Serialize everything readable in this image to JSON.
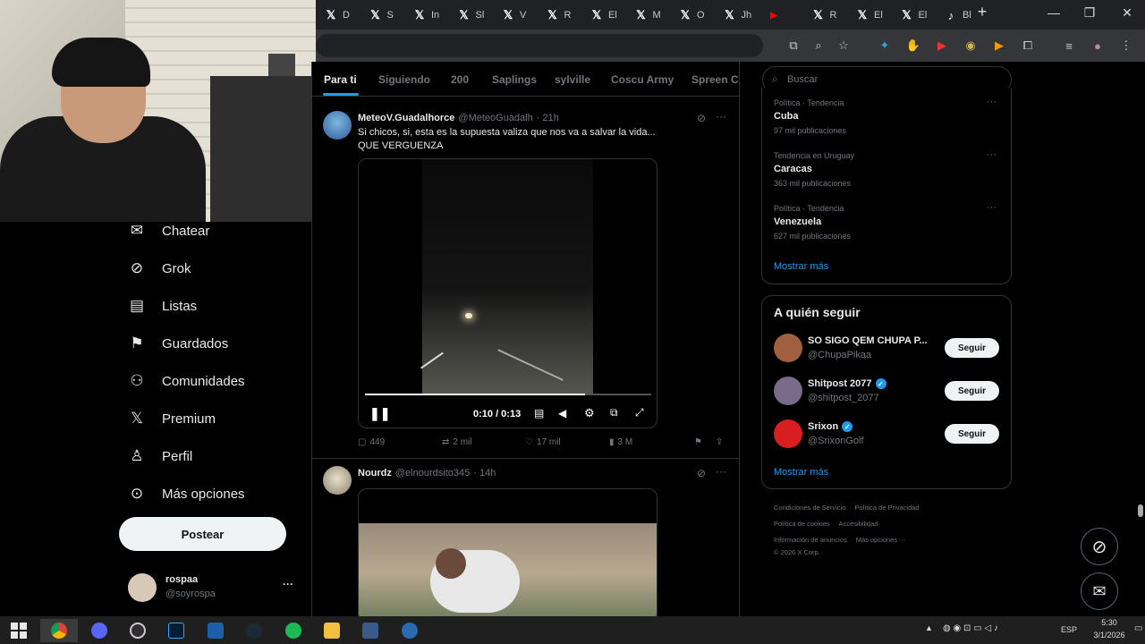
{
  "browser": {
    "tabs": [
      {
        "label": "D",
        "icon": "x-logo-icon"
      },
      {
        "label": "S",
        "icon": "x-logo-icon"
      },
      {
        "label": "In",
        "icon": "x-logo-icon"
      },
      {
        "label": "Sl",
        "icon": "x-logo-icon"
      },
      {
        "label": "V",
        "icon": "x-logo-icon"
      },
      {
        "label": "R",
        "icon": "x-logo-icon"
      },
      {
        "label": "El",
        "icon": "x-logo-icon"
      },
      {
        "label": "M",
        "icon": "x-logo-icon"
      },
      {
        "label": "O",
        "icon": "x-logo-icon"
      },
      {
        "label": "Jh",
        "icon": "x-logo-icon"
      },
      {
        "label": "",
        "icon": "youtube-icon"
      },
      {
        "label": "R",
        "icon": "x-logo-icon"
      },
      {
        "label": "El",
        "icon": "x-logo-icon"
      },
      {
        "label": "El",
        "icon": "x-logo-icon"
      },
      {
        "label": "Bl",
        "icon": "tiktok-icon"
      }
    ],
    "new_tab": "+",
    "minimize": "—",
    "maximize": "❐",
    "close": "✕"
  },
  "timeline_tabs": [
    "Para ti",
    "Siguiendo",
    "200",
    "Saplings",
    "sylville",
    "Coscu Army",
    "Spreen Cl"
  ],
  "nav": [
    {
      "label": "Chatear",
      "icon": "mail-icon"
    },
    {
      "label": "Grok",
      "icon": "grok-icon"
    },
    {
      "label": "Listas",
      "icon": "list-icon"
    },
    {
      "label": "Guardados",
      "icon": "bookmark-icon"
    },
    {
      "label": "Comunidades",
      "icon": "communities-icon"
    },
    {
      "label": "Premium",
      "icon": "x-logo-icon"
    },
    {
      "label": "Perfil",
      "icon": "person-icon"
    },
    {
      "label": "Más opciones",
      "icon": "more-circle-icon"
    }
  ],
  "post_button": "Postear",
  "account": {
    "name": "rospaa",
    "handle": "@soyrospa",
    "more": "···"
  },
  "tweets": [
    {
      "name": "MeteoV.Guadalhorce",
      "handle": "@MeteoGuadalh",
      "time": "· 21h",
      "text_line1": "Si chicos, si, esta es la supuesta valiza que nos va a salvar la vida...",
      "text_line2": "QUE VERGUENZA",
      "video_time": "0:10 / 0:13",
      "video_progress": 0.77,
      "replies": "449",
      "reposts": "2 mil",
      "likes": "17 mil",
      "views": "3 M"
    },
    {
      "name": "Nourdz",
      "handle": "@elnourdsito345",
      "time": "· 14h"
    }
  ],
  "search": {
    "placeholder": "Buscar"
  },
  "trends": [
    {
      "category": "Política · Tendencia",
      "name": "Cuba",
      "count": "97 mil publicaciones"
    },
    {
      "category": "Tendencia en Uruguay",
      "name": "Caracas",
      "count": "363 mil publicaciones"
    },
    {
      "category": "Política · Tendencia",
      "name": "Venezuela",
      "count": "627 mil publicaciones"
    }
  ],
  "trends_more": "Mostrar más",
  "who_to_follow": {
    "title": "A quién seguir",
    "accounts": [
      {
        "name": "SO SIGO QEM CHUPA P...",
        "handle": "@ChupaPikaa",
        "verified": false
      },
      {
        "name": "Shitpost 2077",
        "handle": "@shitpost_2077",
        "verified": true
      },
      {
        "name": "Srixon",
        "handle": "@SrixonGolf",
        "verified": true
      }
    ],
    "follow_label": "Seguir",
    "more": "Mostrar más"
  },
  "footer": {
    "links": [
      "Condiciones de Servicio",
      "Política de Privacidad",
      "Política de cookies",
      "Accesibilidad",
      "Información de anuncios",
      "Más opciones ···"
    ],
    "copyright": "© 2026 X Corp."
  },
  "taskbar": {
    "language": "ESP",
    "time": "5:30",
    "date": "3/1/2026"
  },
  "colors": {
    "accent": "#1d9bf0",
    "bg": "#000000",
    "border": "#2f3336",
    "muted": "#71767b"
  }
}
